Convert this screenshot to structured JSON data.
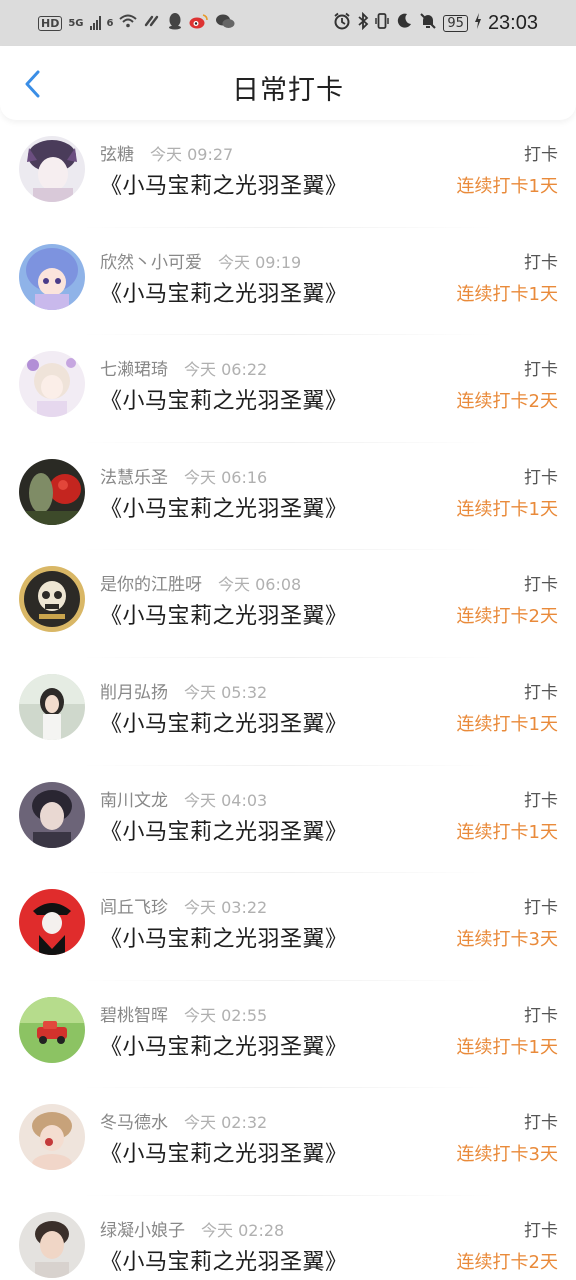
{
  "status_bar": {
    "network_chip": "HD",
    "signal_label": "5G",
    "wifi_label": "6",
    "battery_level": "95",
    "time": "23:03"
  },
  "header": {
    "title": "日常打卡"
  },
  "checkins": [
    {
      "name": "弦糖",
      "time": "今天 09:27",
      "book": "《小马宝莉之光羽圣翼》",
      "action": "打卡",
      "streak": "连续打卡1天"
    },
    {
      "name": "欣然丶小可爱",
      "time": "今天 09:19",
      "book": "《小马宝莉之光羽圣翼》",
      "action": "打卡",
      "streak": "连续打卡1天"
    },
    {
      "name": "七濑珺琦",
      "time": "今天 06:22",
      "book": "《小马宝莉之光羽圣翼》",
      "action": "打卡",
      "streak": "连续打卡2天"
    },
    {
      "name": "法慧乐圣",
      "time": "今天 06:16",
      "book": "《小马宝莉之光羽圣翼》",
      "action": "打卡",
      "streak": "连续打卡1天"
    },
    {
      "name": "是你的江胜呀",
      "time": "今天 06:08",
      "book": "《小马宝莉之光羽圣翼》",
      "action": "打卡",
      "streak": "连续打卡2天"
    },
    {
      "name": "削月弘扬",
      "time": "今天 05:32",
      "book": "《小马宝莉之光羽圣翼》",
      "action": "打卡",
      "streak": "连续打卡1天"
    },
    {
      "name": "南川文龙",
      "time": "今天 04:03",
      "book": "《小马宝莉之光羽圣翼》",
      "action": "打卡",
      "streak": "连续打卡1天"
    },
    {
      "name": "闾丘飞珍",
      "time": "今天 03:22",
      "book": "《小马宝莉之光羽圣翼》",
      "action": "打卡",
      "streak": "连续打卡3天"
    },
    {
      "name": "碧桃智晖",
      "time": "今天 02:55",
      "book": "《小马宝莉之光羽圣翼》",
      "action": "打卡",
      "streak": "连续打卡1天"
    },
    {
      "name": "冬马德水",
      "time": "今天 02:32",
      "book": "《小马宝莉之光羽圣翼》",
      "action": "打卡",
      "streak": "连续打卡3天"
    },
    {
      "name": "绿凝小娘子",
      "time": "今天 02:28",
      "book": "《小马宝莉之光羽圣翼》",
      "action": "打卡",
      "streak": "连续打卡2天"
    }
  ],
  "colors": {
    "accent_back": "#3a8ee6",
    "streak": "#e98a3a",
    "status_bar_bg": "#dcdcdc"
  }
}
